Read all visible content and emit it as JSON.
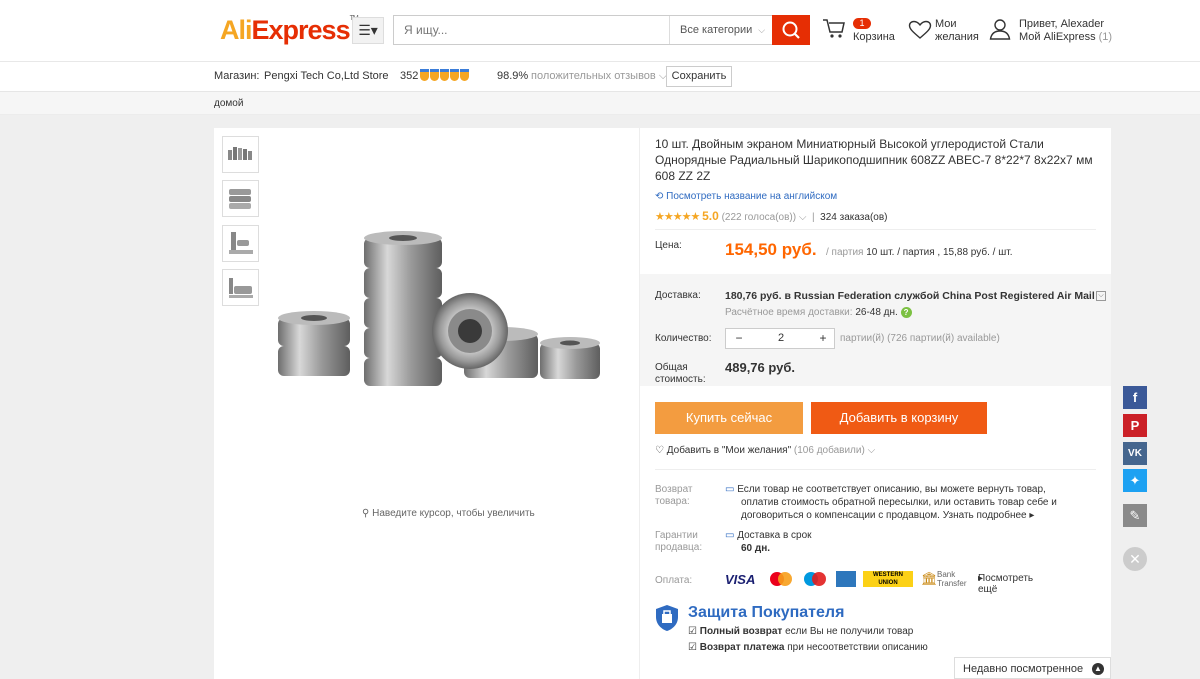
{
  "header": {
    "logo_ali": "Ali",
    "logo_express": "Express",
    "logo_tm": "TM",
    "search_placeholder": "Я ищу...",
    "category_select": "Все категории",
    "cart_count": "1",
    "cart_label": "Корзина",
    "wishlist_line1": "Мои",
    "wishlist_line2": "желания",
    "account_line1": "Привет, Alexader",
    "account_line2": "Мой AliExpress",
    "account_count": "(1)"
  },
  "shop": {
    "label": "Магазин:",
    "name": "Pengxi Tech Co,Ltd Store",
    "score": "352",
    "positive_pct": "98.9%",
    "positive_label": "положительных отзывов",
    "save_button": "Сохранить"
  },
  "breadcrumb": "домой",
  "gallery": {
    "zoom_hint": "Наведите курсор, чтобы увеличить"
  },
  "product": {
    "title": "10 шт. Двойным экраном Миниатюрный Высокой углеродистой Стали Однорядные Радиальный Шарикоподшипник 608ZZ ABEC-7 8*22*7 8x22x7 мм 608 ZZ 2Z",
    "translate_link": "Посмотреть название на английском",
    "rating": "5.0",
    "votes": "(222 голоса(ов))",
    "orders": "324 заказа(ов)",
    "price_label": "Цена:",
    "price": "154,50 руб.",
    "price_unit": "/ партия",
    "price_meta": "10 шт. / партия , 15,88 руб. / шт.",
    "shipping_label": "Доставка:",
    "shipping_price": "180,76 руб.",
    "shipping_rest": "в Russian Federation службой China Post Registered Air Mail",
    "shipping_time_label": "Расчётное время доставки:",
    "shipping_time": "26-48 дн.",
    "quantity_label": "Количество:",
    "quantity": "2",
    "quantity_meta": "партии(й) (726 партии(й) available)",
    "total_label_1": "Общая",
    "total_label_2": "стоимость:",
    "total": "489,76 руб.",
    "buy_now": "Купить сейчас",
    "add_to_cart": "Добавить в корзину",
    "wishlist_add": "Добавить в \"Мои желания\"",
    "wishlist_count": "(106 добавили)",
    "return_label_1": "Возврат",
    "return_label_2": "товара:",
    "return_text_1": "Если товар не соответствует описанию, вы можете вернуть товар,",
    "return_text_2": "оплатив стоимость обратной пересылки, или оставить товар себе и",
    "return_text_3": "договориться о компенсации с продавцом.",
    "return_more": "Узнать подробнее",
    "guarantee_label_1": "Гарантии",
    "guarantee_label_2": "продавца:",
    "guarantee_text": "Доставка в срок",
    "guarantee_days": "60 дн.",
    "payment_label": "Оплата:",
    "payment_visa": "VISA",
    "payment_wu": "WESTERN UNION",
    "payment_bank_1": "Bank",
    "payment_bank_2": "Transfer",
    "payment_more": "Посмотреть ещё",
    "protection_title": "Защита Покупателя",
    "protection_1_bold": "Полный возврат",
    "protection_1_rest": "если Вы не получили товар",
    "protection_2_bold": "Возврат платежа",
    "protection_2_rest": "при несоответствии описанию"
  },
  "recent_viewed": "Недавно посмотренное",
  "colors": {
    "accent": "#e62e04",
    "price": "#ff6600",
    "buy_now": "#f39c40",
    "add_to_cart": "#f05a14",
    "link_blue": "#2f6bc1"
  }
}
